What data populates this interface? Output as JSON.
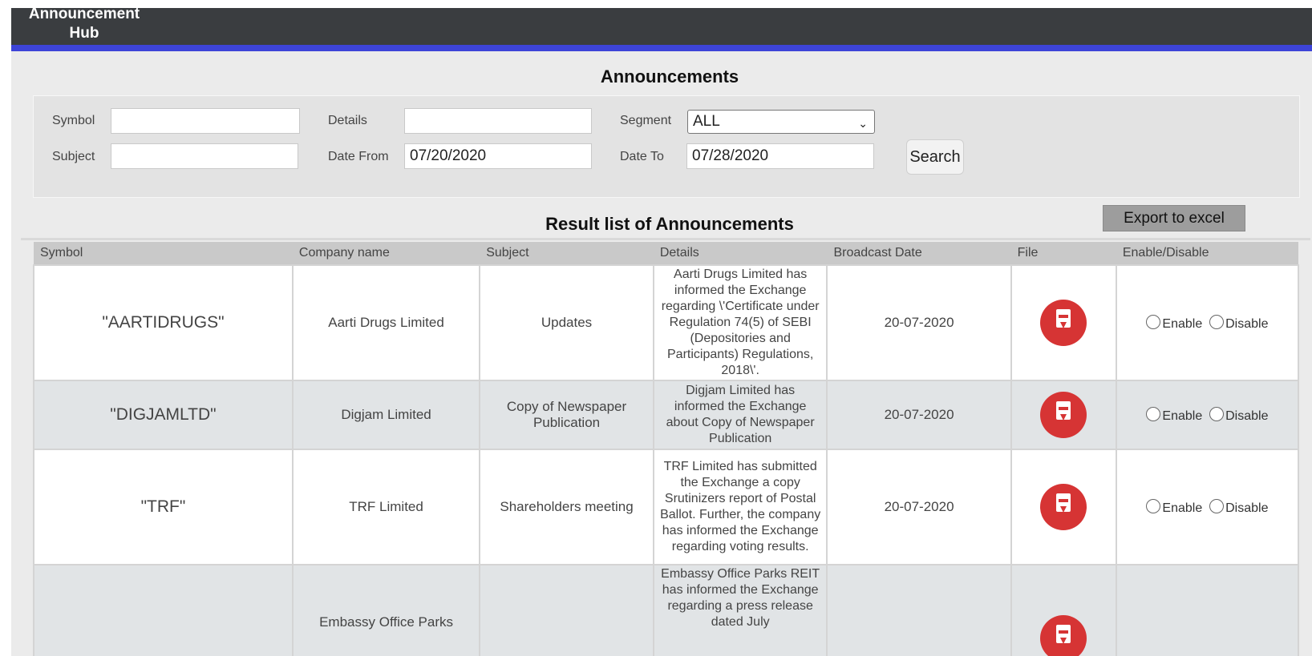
{
  "header": {
    "brand_line1": "Announcement",
    "brand_line2": "Hub"
  },
  "page_title": "Announcements",
  "filters": {
    "symbol_label": "Symbol",
    "symbol_value": "",
    "details_label": "Details",
    "details_value": "",
    "segment_label": "Segment",
    "segment_value": "ALL",
    "subject_label": "Subject",
    "subject_value": "",
    "date_from_label": "Date From",
    "date_from_value": "07/20/2020",
    "date_to_label": "Date To",
    "date_to_value": "07/28/2020",
    "search_label": "Search"
  },
  "results": {
    "title": "Result list of Announcements",
    "export_label": "Export to excel",
    "columns": [
      "Symbol",
      "Company name",
      "Subject",
      "Details",
      "Broadcast Date",
      "File",
      "Enable/Disable"
    ],
    "enable_label": "Enable",
    "disable_label": "Disable",
    "rows": [
      {
        "symbol": "\"AARTIDRUGS\"",
        "company": "Aarti Drugs Limited",
        "subject": "Updates",
        "details": "Aarti Drugs Limited has informed the Exchange regarding \\'Certificate under Regulation 74(5) of SEBI (Depositories and Participants) Regulations, 2018\\'.",
        "date": "20-07-2020",
        "file_icon": "pdf-download-icon"
      },
      {
        "symbol": "\"DIGJAMLTD\"",
        "company": "Digjam Limited",
        "subject": "Copy of Newspaper Publication",
        "details": "Digjam Limited has informed the Exchange about Copy of Newspaper Publication",
        "date": "20-07-2020",
        "file_icon": "pdf-download-icon"
      },
      {
        "symbol": "\"TRF\"",
        "company": "TRF Limited",
        "subject": "Shareholders meeting",
        "details": "TRF Limited has submitted the Exchange a copy Srutinizers report of Postal Ballot. Further, the company has informed the Exchange regarding voting results.",
        "date": "20-07-2020",
        "file_icon": "pdf-download-icon"
      },
      {
        "symbol": "",
        "company": "Embassy Office Parks",
        "subject": "",
        "details": "Embassy Office Parks REIT has informed the Exchange regarding a press release dated July",
        "date": "",
        "file_icon": "pdf-download-icon"
      }
    ]
  }
}
